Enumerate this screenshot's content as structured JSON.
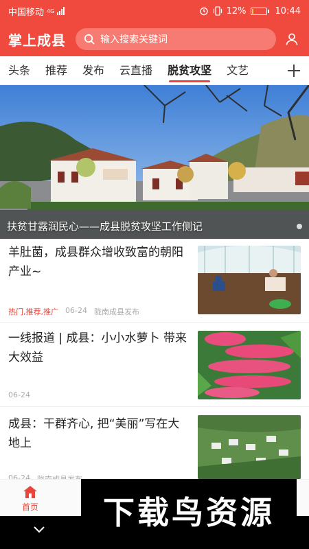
{
  "status_bar": {
    "carrier": "中国移动",
    "net": "4G",
    "battery_pct": "12%",
    "battery_level": 0.12,
    "time": "10:44"
  },
  "header": {
    "app_title": "掌上成县",
    "search_placeholder": "输入搜索关键词"
  },
  "tabs": [
    {
      "label": "头条"
    },
    {
      "label": "推荐"
    },
    {
      "label": "发布"
    },
    {
      "label": "云直播"
    },
    {
      "label": "脱贫攻坚",
      "active": true
    },
    {
      "label": "文艺"
    }
  ],
  "hero": {
    "caption": "扶贫甘露润民心——成县脱贫攻坚工作侧记"
  },
  "news": [
    {
      "title": "羊肚菌，成县群众增收致富的朝阳产业~",
      "tags": "热门,推荐,推广",
      "date": "06-24",
      "source": "陇南成县发布"
    },
    {
      "title": "一线报道 | 成县：小小水萝卜 带来大效益",
      "date": "06-24"
    },
    {
      "title": "成县：干群齐心, 把“美丽”写在大地上",
      "date": "06-24",
      "source": "陇南成县发布"
    }
  ],
  "bottom_nav": {
    "home_label": "首页"
  },
  "watermark": "下载鸟资源",
  "colors": {
    "brand_red": "#f04a3e",
    "accent": "#e8463c"
  }
}
